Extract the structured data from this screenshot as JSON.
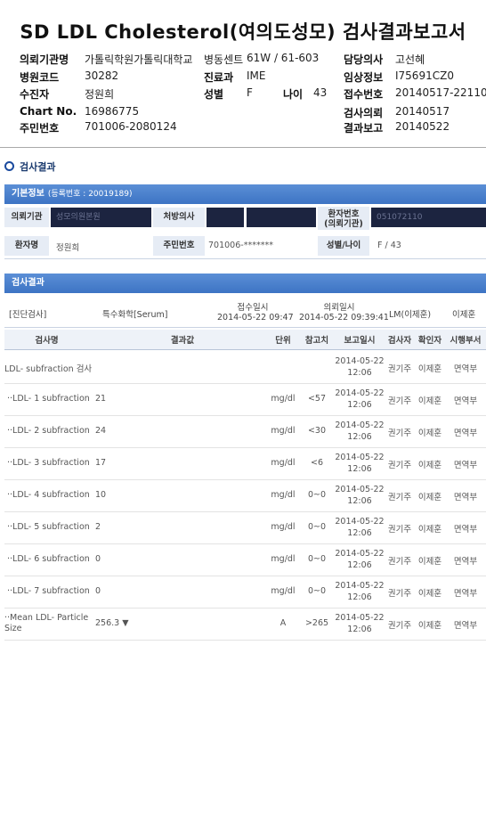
{
  "report": {
    "title": "SD LDL Cholesterol(여의도성모) 검사결과보고서",
    "fields": {
      "institution_label": "의뢰기관명",
      "institution": "가톨릭학원가톨릭대학교",
      "ward_label": "병동센트",
      "ward": "61W / 61-603",
      "doctor_label": "담당의사",
      "doctor": "고선혜",
      "hospital_code_label": "병원코드",
      "hospital_code": "30282",
      "dept_label": "진료과",
      "dept": "IME",
      "clinical_label": "임상정보",
      "clinical": "I75691CZ0",
      "recipient_label": "수진자",
      "recipient": "정원희",
      "sex_label": "성별",
      "sex": "F",
      "age_label": "나이",
      "age": "43",
      "receipt_label": "접수번호",
      "receipt": "20140517-22110",
      "chart_label": "Chart No.",
      "chart": "16986775",
      "request_label": "검사의뢰",
      "request": "20140517",
      "rrn_label": "주민번호",
      "rrn": "701006-2080124",
      "result_report_label": "결과보고",
      "result_report": "20140522"
    }
  },
  "section_title": "검사결과",
  "basic_info": {
    "bar_title": "기본정보",
    "bar_sub": "(등록번호 : 20019189)",
    "institution_label": "의뢰기관",
    "institution_value": "성모의원본원",
    "doctor_label": "처방의사",
    "patient_no_label": "환자번호\n(의뢰기관)",
    "patient_no_value": "051072110",
    "name_label": "환자명",
    "name_value": "정원희",
    "rrn_label": "주민번호",
    "rrn_value": "701006-*******",
    "sexage_label": "성별/나이",
    "sexage_value": "F / 43"
  },
  "results_bar": "검사결과",
  "summary": {
    "category": "[진단검사]",
    "specimen": "특수화학[Serum]",
    "receipt_time_label": "접수일시",
    "receipt_time": "2014-05-22 09:47",
    "request_time_label": "의뢰일시",
    "request_time": "2014-05-22 09:39:41",
    "lm": "LM(이제훈)",
    "confirmer": "이제훈"
  },
  "columns": [
    "검사명",
    "결과값",
    "단위",
    "참고치",
    "보고일시",
    "검사자",
    "확인자",
    "시행부서"
  ],
  "rows": [
    {
      "name": "LDL- subfraction 검사",
      "value": "",
      "unit": "",
      "ref": "",
      "date": "2014-05-22",
      "time": "12:06",
      "tester": "권기주",
      "confirmer": "이제훈",
      "dept": "면역부"
    },
    {
      "name": "··LDL- 1 subfraction",
      "value": "21",
      "unit": "mg/dl",
      "ref": "<57",
      "date": "2014-05-22",
      "time": "12:06",
      "tester": "권기주",
      "confirmer": "이제훈",
      "dept": "면역부"
    },
    {
      "name": "··LDL- 2 subfraction",
      "value": "24",
      "unit": "mg/dl",
      "ref": "<30",
      "date": "2014-05-22",
      "time": "12:06",
      "tester": "권기주",
      "confirmer": "이제훈",
      "dept": "면역부"
    },
    {
      "name": "··LDL- 3 subfraction",
      "value": "17",
      "unit": "mg/dl",
      "ref": "<6",
      "date": "2014-05-22",
      "time": "12:06",
      "tester": "권기주",
      "confirmer": "이제훈",
      "dept": "면역부"
    },
    {
      "name": "··LDL- 4 subfraction",
      "value": "10",
      "unit": "mg/dl",
      "ref": "0~0",
      "date": "2014-05-22",
      "time": "12:06",
      "tester": "권기주",
      "confirmer": "이제훈",
      "dept": "면역부"
    },
    {
      "name": "··LDL- 5 subfraction",
      "value": "2",
      "unit": "mg/dl",
      "ref": "0~0",
      "date": "2014-05-22",
      "time": "12:06",
      "tester": "권기주",
      "confirmer": "이제훈",
      "dept": "면역부"
    },
    {
      "name": "··LDL- 6 subfraction",
      "value": "0",
      "unit": "mg/dl",
      "ref": "0~0",
      "date": "2014-05-22",
      "time": "12:06",
      "tester": "권기주",
      "confirmer": "이제훈",
      "dept": "면역부"
    },
    {
      "name": "··LDL- 7 subfraction",
      "value": "0",
      "unit": "mg/dl",
      "ref": "0~0",
      "date": "2014-05-22",
      "time": "12:06",
      "tester": "권기주",
      "confirmer": "이제훈",
      "dept": "면역부"
    },
    {
      "name": "··Mean LDL- Particle Size",
      "value": "256.3 ▼",
      "unit": "A",
      "ref": ">265",
      "date": "2014-05-22",
      "time": "12:06",
      "tester": "권기주",
      "confirmer": "이제훈",
      "dept": "면역부"
    }
  ]
}
